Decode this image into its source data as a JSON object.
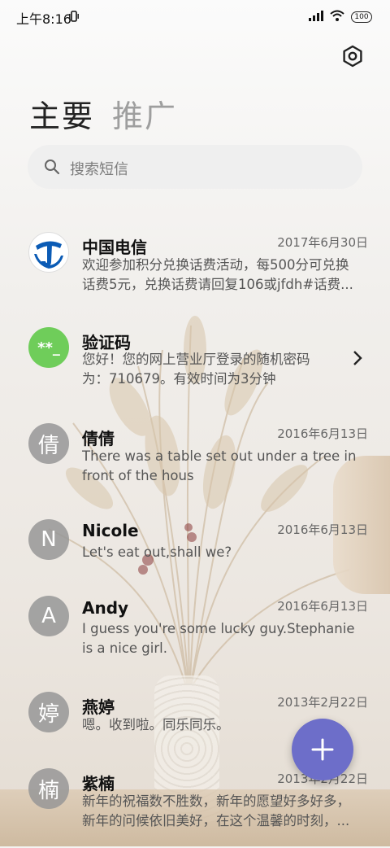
{
  "status_bar": {
    "time": "上午8:16",
    "battery": "100"
  },
  "tabs": [
    {
      "label": "主要",
      "active": true
    },
    {
      "label": "推广",
      "active": false
    }
  ],
  "search": {
    "placeholder": "搜索短信"
  },
  "conversations": [
    {
      "name": "中国电信",
      "date": "2017年6月30日",
      "preview_lines": [
        "欢迎参加积分兑换话费活动，每500分可兑换",
        "话费5元，兑换话费请回复106或jfdh#话费..."
      ],
      "avatar_text": "",
      "avatar_icon": "china-telecom-logo-icon"
    },
    {
      "name": "验证码",
      "date": "",
      "preview_lines": [
        "您好！您的网上营业厅登录的随机密码",
        "为：710679。有效时间为3分钟"
      ],
      "avatar_text": "**_",
      "avatar_color": "#6fcd5a"
    },
    {
      "name": "倩倩",
      "date": "2016年6月13日",
      "preview_lines": [
        "There was a table set out under a tree in",
        "front of the hous"
      ],
      "avatar_text": "倩"
    },
    {
      "name": "Nicole",
      "date": "2016年6月13日",
      "preview_lines": [
        "Let's eat out,shall we?"
      ],
      "avatar_text": "N"
    },
    {
      "name": "Andy",
      "date": "2016年6月13日",
      "preview_lines": [
        "I guess you're some lucky guy.Stephanie",
        "is a nice girl."
      ],
      "avatar_text": "A"
    },
    {
      "name": "燕婷",
      "date": "2013年2月22日",
      "preview_lines": [
        "嗯。收到啦。同乐同乐。"
      ],
      "avatar_text": "婷"
    },
    {
      "name": "紫楠",
      "date": "2013年2月22日",
      "preview_lines": [
        "新年的祝福数不胜数，新年的愿望好多好多，",
        "新年的问候依旧美好，在这个温馨的时刻，..."
      ],
      "avatar_text": "楠"
    }
  ],
  "colors": {
    "accent": "#6d6ec9",
    "verify_green": "#6fcd5a",
    "telecom_blue": "#0b5bb5"
  }
}
